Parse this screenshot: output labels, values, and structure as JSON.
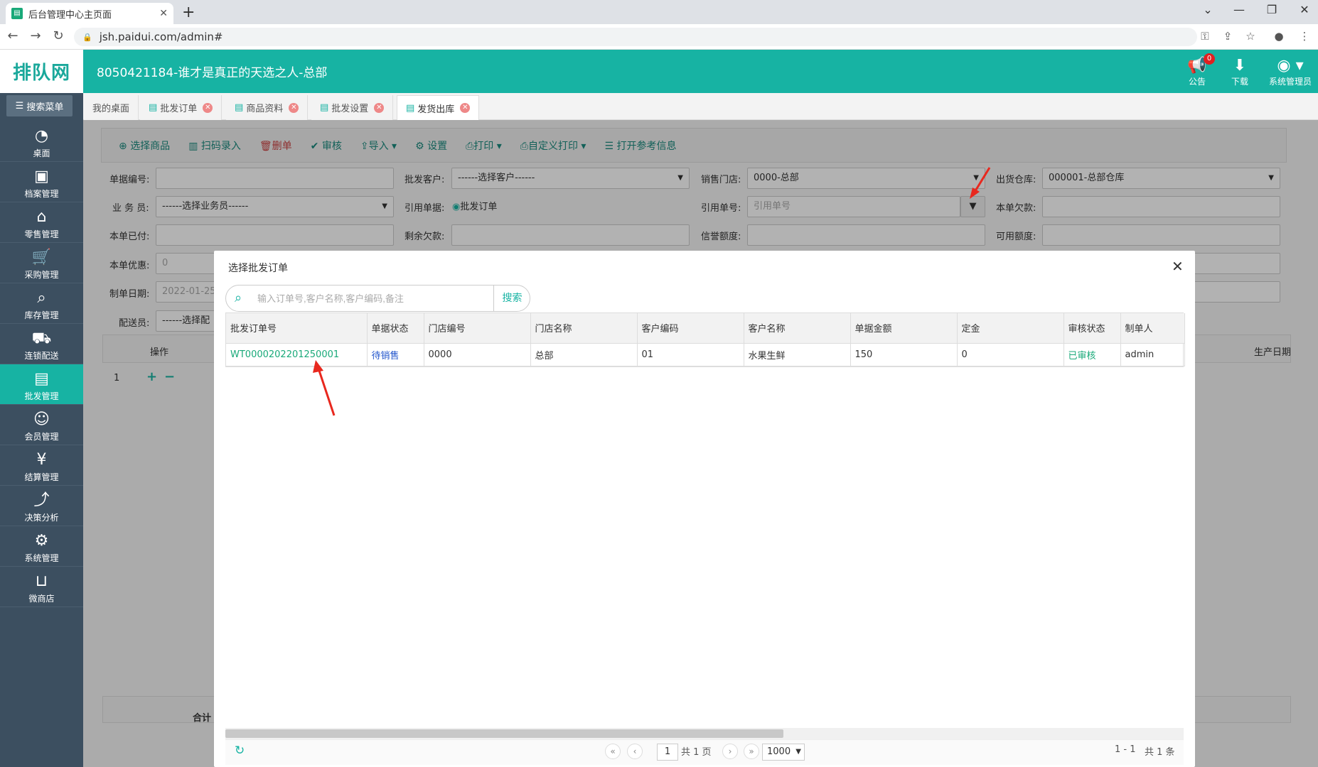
{
  "browser": {
    "tab_title": "后台管理中心主页面",
    "url": "jsh.paidui.com/admin#"
  },
  "header": {
    "logo": "排队网",
    "org_title": "8050421184-谁才是真正的天选之人-总部",
    "notice_label": "公告",
    "notice_badge": "0",
    "download_label": "下载",
    "user_label": "系统管理员"
  },
  "sidebar": {
    "search_label": "搜索菜单",
    "items": [
      {
        "label": "桌面",
        "icon": "dashboard-icon"
      },
      {
        "label": "档案管理",
        "icon": "archive-icon"
      },
      {
        "label": "零售管理",
        "icon": "store-icon"
      },
      {
        "label": "采购管理",
        "icon": "cart-icon"
      },
      {
        "label": "库存管理",
        "icon": "inventory-icon"
      },
      {
        "label": "连锁配送",
        "icon": "delivery-icon"
      },
      {
        "label": "批发管理",
        "icon": "wholesale-icon"
      },
      {
        "label": "会员管理",
        "icon": "member-icon"
      },
      {
        "label": "结算管理",
        "icon": "settlement-icon"
      },
      {
        "label": "决策分析",
        "icon": "analysis-icon"
      },
      {
        "label": "系统管理",
        "icon": "gear-icon"
      },
      {
        "label": "微商店",
        "icon": "shop-bag-icon"
      }
    ]
  },
  "page_tabs": [
    {
      "label": "我的桌面"
    },
    {
      "label": "批发订单"
    },
    {
      "label": "商品资料"
    },
    {
      "label": "批发设置"
    },
    {
      "label": "发货出库"
    }
  ],
  "toolbar": {
    "select_goods": "选择商品",
    "scan": "扫码录入",
    "delete_row": "删单",
    "audit": "审核",
    "import": "导入",
    "settings": "设置",
    "print": "打印",
    "custom_print": "自定义打印",
    "open_ref": "打开参考信息"
  },
  "form": {
    "doc_no_label": "单据编号:",
    "customer_label": "批发客户:",
    "customer_value": "------选择客户------",
    "store_label": "销售门店:",
    "store_value": "0000-总部",
    "warehouse_label": "出货仓库:",
    "warehouse_value": "000001-总部仓库",
    "salesman_label": "业 务 员:",
    "salesman_value": "------选择业务员------",
    "ref_doc_label": "引用单据:",
    "ref_doc_value": "批发订单",
    "ref_no_label": "引用单号:",
    "ref_no_placeholder": "引用单号",
    "owed_label": "本单欠款:",
    "paid_label": "本单已付:",
    "remaining_label": "剩余欠款:",
    "credit_label": "信誉额度:",
    "available_label": "可用额度:",
    "discount_label": "本单优惠:",
    "discount_value": "0",
    "date_label": "制单日期:",
    "date_value": "2022-01-25",
    "deliver_label": "配送员:",
    "deliver_value": "------选择配",
    "grid_op": "操作",
    "grid_prod_date": "生产日期",
    "row_no": "1",
    "total_label": "合计"
  },
  "dialog": {
    "title": "选择批发订单",
    "search_placeholder": "输入订单号,客户名称,客户编码,备注",
    "search_button": "搜索",
    "columns": [
      "批发订单号",
      "单据状态",
      "门店编号",
      "门店名称",
      "客户编码",
      "客户名称",
      "单据金额",
      "定金",
      "审核状态",
      "制单人"
    ],
    "rows": [
      {
        "order_no": "WT0000202201250001",
        "status": "待销售",
        "store_code": "0000",
        "store_name": "总部",
        "customer_code": "01",
        "customer_name": "水果生鲜",
        "amount": "150",
        "deposit": "0",
        "audit": "已审核",
        "creator": "admin"
      }
    ],
    "pager": {
      "page": "1",
      "total_pages": "共 1 页",
      "page_size": "1000",
      "range": "1 - 1",
      "total": "共 1 条"
    }
  },
  "colors": {
    "accent": "#17b3a3",
    "sidebar": "#3c4f60",
    "link": "#19a979",
    "status_blue": "#2255cc",
    "audit_green": "#19a979",
    "arrow": "#e8281e"
  }
}
